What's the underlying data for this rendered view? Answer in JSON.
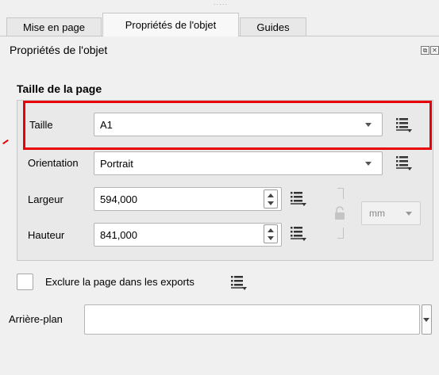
{
  "tabs": [
    {
      "label": "Mise en page",
      "active": false
    },
    {
      "label": "Propriétés de l'objet",
      "active": true
    },
    {
      "label": "Guides",
      "active": false
    }
  ],
  "dock": {
    "title": "Propriétés de l'objet",
    "float_glyph": "⧉",
    "close_glyph": "✕"
  },
  "page_size": {
    "section_title": "Taille de la page",
    "size": {
      "label": "Taille",
      "value": "A1"
    },
    "orientation": {
      "label": "Orientation",
      "value": "Portrait"
    },
    "width": {
      "label": "Largeur",
      "value": "594,000"
    },
    "height": {
      "label": "Hauteur",
      "value": "841,000"
    },
    "unit": {
      "value": "mm"
    }
  },
  "exclude": {
    "label": "Exclure la page dans les exports",
    "checked": false
  },
  "background": {
    "label": "Arrière-plan",
    "value": ""
  },
  "colors": {
    "highlight": "#e8000b",
    "accent_blue": "#3a73b9"
  },
  "icons": {
    "data_defined": "data-defined-override-icon",
    "lock": "padlock-icon"
  }
}
